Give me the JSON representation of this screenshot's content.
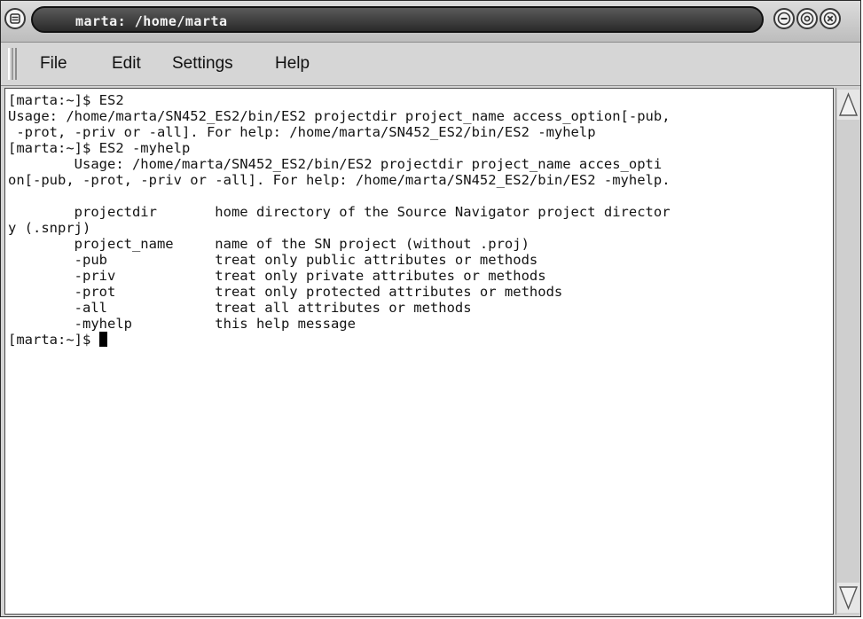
{
  "window": {
    "title": "marta: /home/marta"
  },
  "menubar": {
    "items": [
      {
        "label": "File"
      },
      {
        "label": "Edit"
      },
      {
        "label": "Settings"
      },
      {
        "label": "Help"
      }
    ]
  },
  "terminal": {
    "lines": [
      "[marta:~]$ ES2",
      "Usage: /home/marta/SN452_ES2/bin/ES2 projectdir project_name access_option[-pub,",
      " -prot, -priv or -all]. For help: /home/marta/SN452_ES2/bin/ES2 -myhelp",
      "[marta:~]$ ES2 -myhelp",
      "        Usage: /home/marta/SN452_ES2/bin/ES2 projectdir project_name acces_opti",
      "on[-pub, -prot, -priv or -all]. For help: /home/marta/SN452_ES2/bin/ES2 -myhelp.",
      "",
      "        projectdir       home directory of the Source Navigator project director",
      "y (.snprj)",
      "        project_name     name of the SN project (without .proj)",
      "        -pub             treat only public attributes or methods",
      "        -priv            treat only private attributes or methods",
      "        -prot            treat only protected attributes or methods",
      "        -all             treat all attributes or methods",
      "        -myhelp          this help message"
    ],
    "prompt": "[marta:~]$ "
  },
  "icons": {
    "window_menu": "window-menu-icon",
    "minimize": "minimize-icon",
    "maximize": "maximize-icon",
    "close": "close-icon",
    "scroll_up": "scroll-up-arrow-icon",
    "scroll_down": "scroll-down-arrow-icon"
  }
}
